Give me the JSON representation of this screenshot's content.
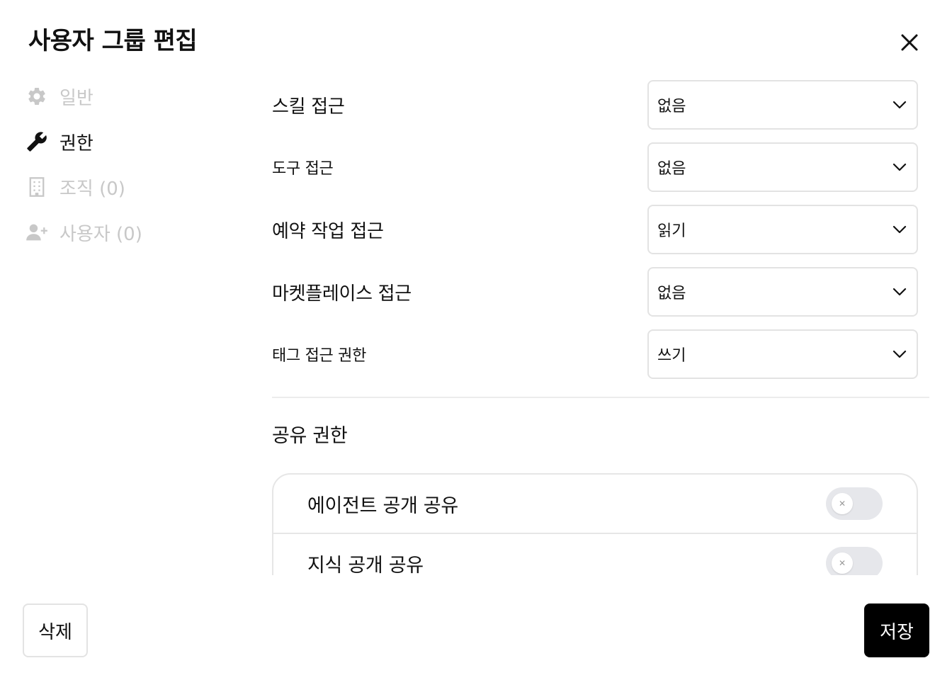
{
  "dialog": {
    "title": "사용자 그룹 편집"
  },
  "sidebar": {
    "items": [
      {
        "label": "일반",
        "icon": "gear-icon",
        "active": false
      },
      {
        "label": "권한",
        "icon": "wrench-icon",
        "active": true
      },
      {
        "label": "조직 (0)",
        "icon": "building-icon",
        "active": false
      },
      {
        "label": "사용자 (0)",
        "icon": "user-plus-icon",
        "active": false
      }
    ]
  },
  "permissions": [
    {
      "label": "스킬 접근",
      "value": "없음"
    },
    {
      "label": "도구 접근",
      "value": "없음"
    },
    {
      "label": "예약 작업 접근",
      "value": "읽기"
    },
    {
      "label": "마켓플레이스 접근",
      "value": "없음"
    },
    {
      "label": "태그 접근 권한",
      "value": "쓰기"
    }
  ],
  "sharing": {
    "title": "공유 권한",
    "items": [
      {
        "label": "에이전트 공개 공유",
        "enabled": false
      },
      {
        "label": "지식 공개 공유",
        "enabled": false
      }
    ]
  },
  "footer": {
    "delete_label": "삭제",
    "save_label": "저장"
  },
  "colors": {
    "accent": "#000000",
    "inactive_text": "#c8c8c8",
    "border": "#e3e3e3",
    "toggle_off": "#e6e7eb"
  }
}
